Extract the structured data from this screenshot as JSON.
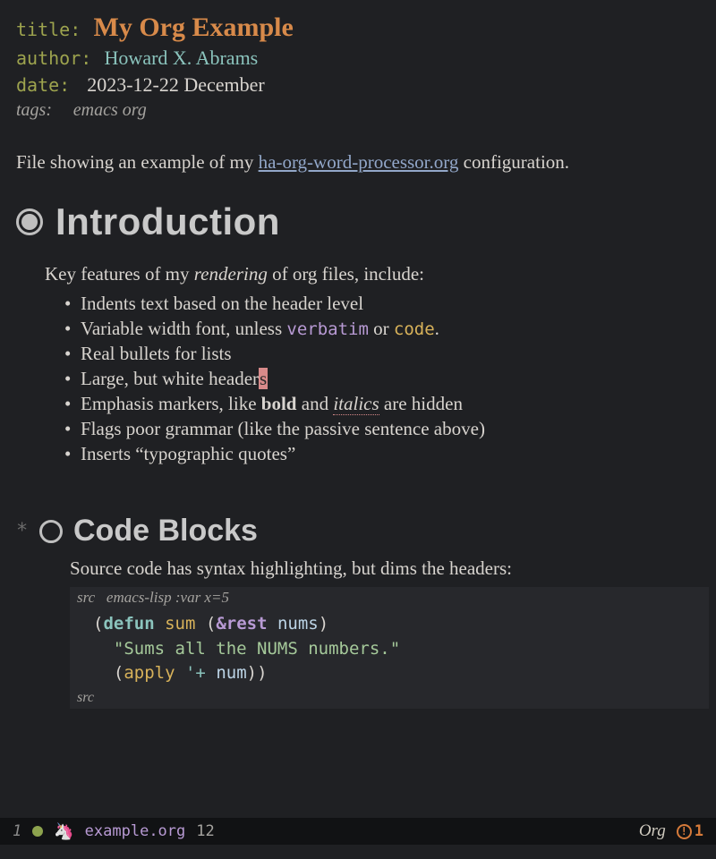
{
  "meta": {
    "title_key": "title:",
    "title_val": "My Org Example",
    "author_key": "author:",
    "author_val": "Howard X. Abrams",
    "date_key": "date:",
    "date_val": "2023-12-22 December",
    "tags_key": "tags:",
    "tags_val": "emacs org"
  },
  "intro": {
    "pre": "File showing an example of my ",
    "link": "ha-org-word-processor.org",
    "post": " configuration."
  },
  "h1": {
    "text": "Introduction"
  },
  "section1": {
    "para_pre": "Key features of my ",
    "para_em": "rendering",
    "para_post": " of org files, include:",
    "b1": "Indents text based on the header level",
    "b2_pre": "Variable width font, unless ",
    "b2_verbatim": "verbatim",
    "b2_mid": " or ",
    "b2_code": "code",
    "b2_post": ".",
    "b3": "Real bullets for lists",
    "b4_pre": "Large, but white header",
    "b4_cursor": "s",
    "b5_pre": "Emphasis markers, like ",
    "b5_bold": "bold",
    "b5_mid": " and ",
    "b5_italics": "italics",
    "b5_post": " are hidden",
    "b6": "Flags poor grammar (like the passive sentence above)",
    "b7": "Inserts “typographic quotes”"
  },
  "h2": {
    "star": "*",
    "text": "Code Blocks"
  },
  "section2": {
    "para": "Source code has syntax highlighting, but dims the headers:",
    "src_label": "src",
    "src_lang": "emacs-lisp :var x=5",
    "code": {
      "line1_open": "(",
      "line1_defun": "defun",
      "line1_sp1": " ",
      "line1_name": "sum",
      "line1_sp2": " (",
      "line1_rest": "&rest",
      "line1_sp3": " ",
      "line1_arg": "nums",
      "line1_close": ")",
      "line2_indent": "  ",
      "line2_str": "\"Sums all the NUMS numbers.\"",
      "line3_indent": "  (",
      "line3_apply": "apply",
      "line3_sp": " ",
      "line3_quote": "'+",
      "line3_sp2": " ",
      "line3_arg": "num",
      "line3_close": "))"
    },
    "src_end": "src"
  },
  "modeline": {
    "line": "1",
    "file": "example.org",
    "col": "12",
    "mode": "Org",
    "warn_count": "1"
  }
}
